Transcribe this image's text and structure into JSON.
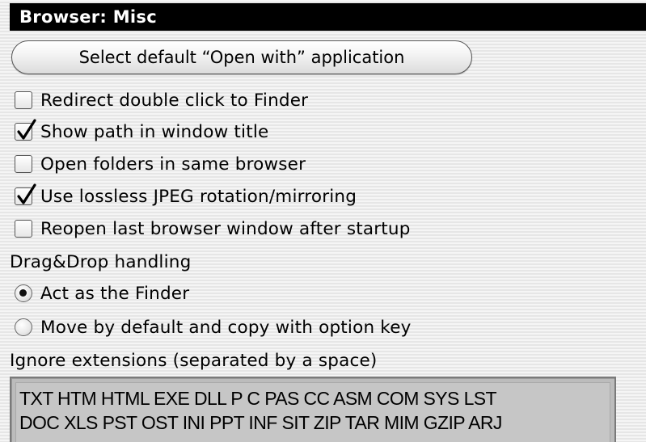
{
  "window": {
    "title": "Browser: Misc"
  },
  "open_with_button": {
    "label": "Select default “Open with” application"
  },
  "options": [
    {
      "label": "Redirect double click to Finder",
      "checked": false
    },
    {
      "label": "Show path in window title",
      "checked": true
    },
    {
      "label": "Open folders in same browser",
      "checked": false
    },
    {
      "label": "Use lossless JPEG rotation/mirroring",
      "checked": true
    },
    {
      "label": "Reopen last browser window after startup",
      "checked": false
    }
  ],
  "drag_drop": {
    "heading": "Drag&Drop handling",
    "choices": [
      {
        "label": "Act as the Finder",
        "selected": true
      },
      {
        "label": "Move by default and copy with option key",
        "selected": false
      }
    ]
  },
  "ignore_extensions": {
    "heading": "Ignore extensions (separated by a space)",
    "value_lines": [
      "TXT HTM HTML EXE DLL P C PAS CC ASM COM SYS LST",
      "DOC XLS PST OST INI PPT INF SIT ZIP TAR MIM GZIP ARJ"
    ]
  },
  "colors": {
    "titlebar_bg": "#000000",
    "titlebar_text": "#ffffff",
    "field_bg": "#c6c6c6"
  }
}
